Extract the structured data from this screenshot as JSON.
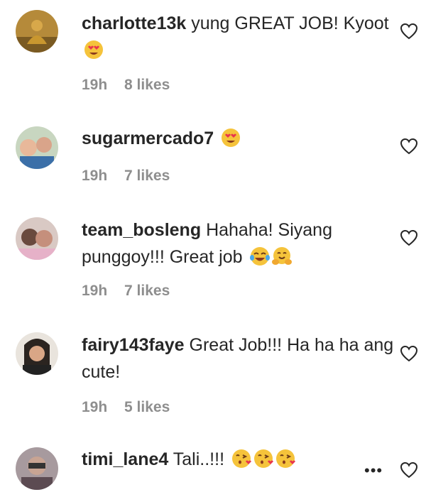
{
  "comments": [
    {
      "username": "charlotte13k",
      "text": "yung GREAT JOB! Kyoot",
      "emojis": [
        "heart-eyes-emoji"
      ],
      "time": "19h",
      "likes": "8 likes"
    },
    {
      "username": "sugarmercado7",
      "text": "",
      "emojis": [
        "heart-eyes-emoji"
      ],
      "time": "19h",
      "likes": "7 likes"
    },
    {
      "username": "team_bosleng",
      "text": "Hahaha! Siyang punggoy!!! Great job",
      "emojis": [
        "tears-of-joy-emoji",
        "hugging-face-emoji"
      ],
      "time": "19h",
      "likes": "7 likes"
    },
    {
      "username": "fairy143faye",
      "text": "Great Job!!! Ha ha ha ang cute!",
      "emojis": [],
      "time": "19h",
      "likes": "5 likes"
    },
    {
      "username": "timi_lane4",
      "text": "Tali..!!!",
      "emojis": [
        "kissing-face-emoji",
        "kissing-face-emoji",
        "kissing-face-emoji"
      ],
      "more_options": "•••"
    }
  ],
  "icons": {
    "like": "heart-outline-icon",
    "more": "more-options-icon"
  },
  "colors": {
    "text": "#262626",
    "meta": "#8e8e8e",
    "emoji_face": "#f5c33b"
  }
}
